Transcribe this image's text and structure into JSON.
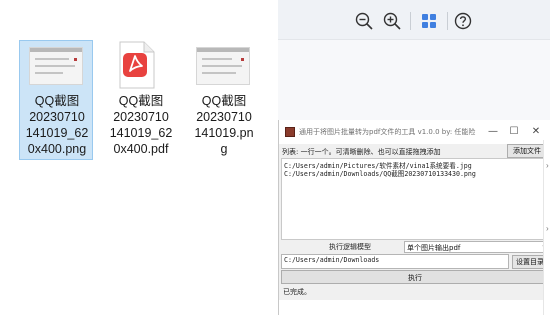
{
  "explorer": {
    "files": [
      {
        "name": "QQ截图\n20230710\n141019_62\n0x400.png",
        "type": "png",
        "selected": true
      },
      {
        "name": "QQ截图\n20230710\n141019_62\n0x400.pdf",
        "type": "pdf",
        "selected": false
      },
      {
        "name": "QQ截图\n20230710\n141019.pn\ng",
        "type": "png",
        "selected": false
      }
    ]
  },
  "viewer_toolbar": {
    "zoom_out_icon": "zoom-out-icon",
    "zoom_in_icon": "zoom-in-icon",
    "grid_icon": "grid-view-icon",
    "help_icon": "help-icon",
    "accent": "#3f7fe0"
  },
  "tool_window": {
    "title": "通用于将图片批量转为pdf文件的工具 v1.0.0   by: 任能险",
    "minimize": "—",
    "maximize": "☐",
    "close": "✕",
    "hint": "列表: 一行一个。可清晰删除、也可以直接拖拽添加",
    "add_file_button": "添加文件",
    "file_paths": [
      "C:/Users/admin/Pictures/软件素材/vina1系统要看.jpg",
      "C:/Users/admin/Downloads/QQ截图20230710133430.png"
    ],
    "mode_label": "执行逻辑模型",
    "mode_value": "单个图片输出pdf",
    "output_dir": "C:/Users/admin/Downloads",
    "set_dir_button": "设置目录",
    "run_button": "执行",
    "status": "已完成。"
  }
}
